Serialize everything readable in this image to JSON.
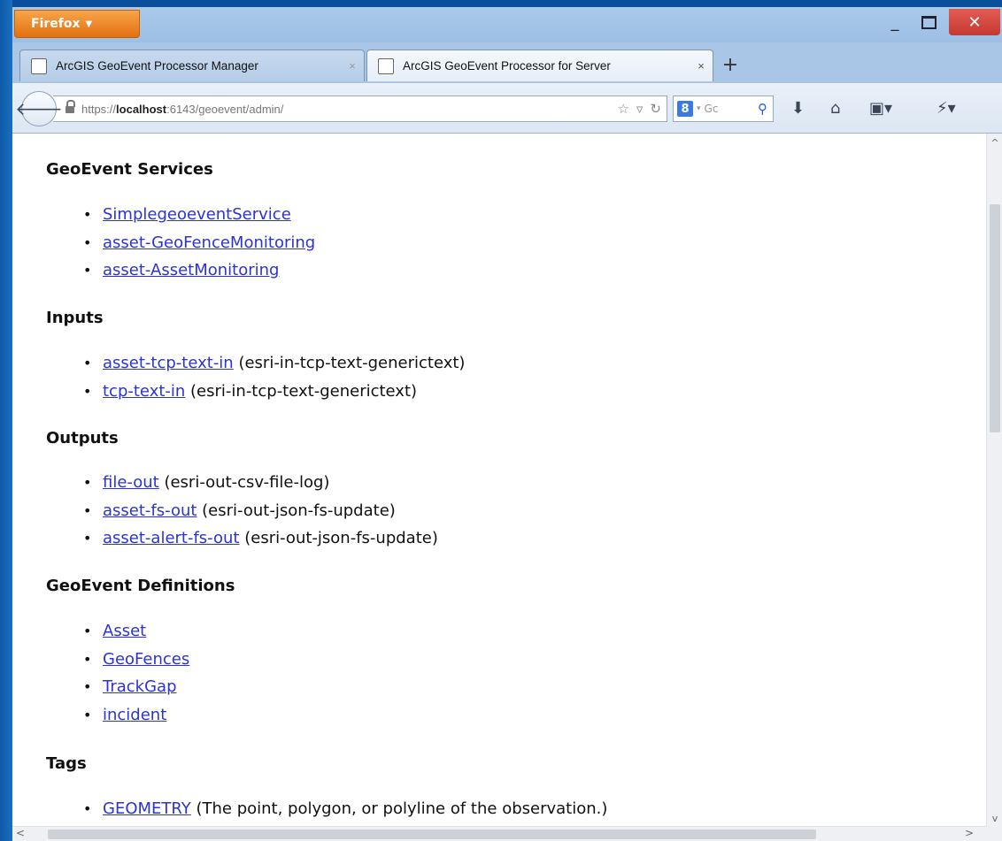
{
  "browser": {
    "menu_button": "Firefox",
    "tabs": [
      {
        "label": "ArcGIS GeoEvent Processor Manager",
        "close": "×"
      },
      {
        "label": "ArcGIS GeoEvent Processor for Server",
        "close": "×"
      }
    ],
    "new_tab": "+",
    "url": {
      "prefix": "https://",
      "host": "localhost",
      "rest": ":6143/geoevent/admin/"
    },
    "search_placeholder": "Gc",
    "accent_color": "#e2700f"
  },
  "page": {
    "sections": [
      {
        "heading": "GeoEvent Services",
        "items": [
          {
            "link": "SimplegeoeventService",
            "note": ""
          },
          {
            "link": "asset-GeoFenceMonitoring",
            "note": ""
          },
          {
            "link": "asset-AssetMonitoring",
            "note": ""
          }
        ]
      },
      {
        "heading": "Inputs",
        "items": [
          {
            "link": "asset-tcp-text-in",
            "note": " (esri-in-tcp-text-generictext)"
          },
          {
            "link": "tcp-text-in",
            "note": " (esri-in-tcp-text-generictext)"
          }
        ]
      },
      {
        "heading": "Outputs",
        "items": [
          {
            "link": "file-out",
            "note": " (esri-out-csv-file-log)"
          },
          {
            "link": "asset-fs-out",
            "note": " (esri-out-json-fs-update)"
          },
          {
            "link": "asset-alert-fs-out",
            "note": " (esri-out-json-fs-update)"
          }
        ]
      },
      {
        "heading": "GeoEvent Definitions",
        "items": [
          {
            "link": "Asset",
            "note": ""
          },
          {
            "link": "GeoFences",
            "note": ""
          },
          {
            "link": "TrackGap",
            "note": ""
          },
          {
            "link": "incident",
            "note": ""
          }
        ]
      },
      {
        "heading": "Tags",
        "items": [
          {
            "link": "GEOMETRY",
            "note": " (The point, polygon, or polyline of the observation.)"
          }
        ]
      }
    ]
  }
}
